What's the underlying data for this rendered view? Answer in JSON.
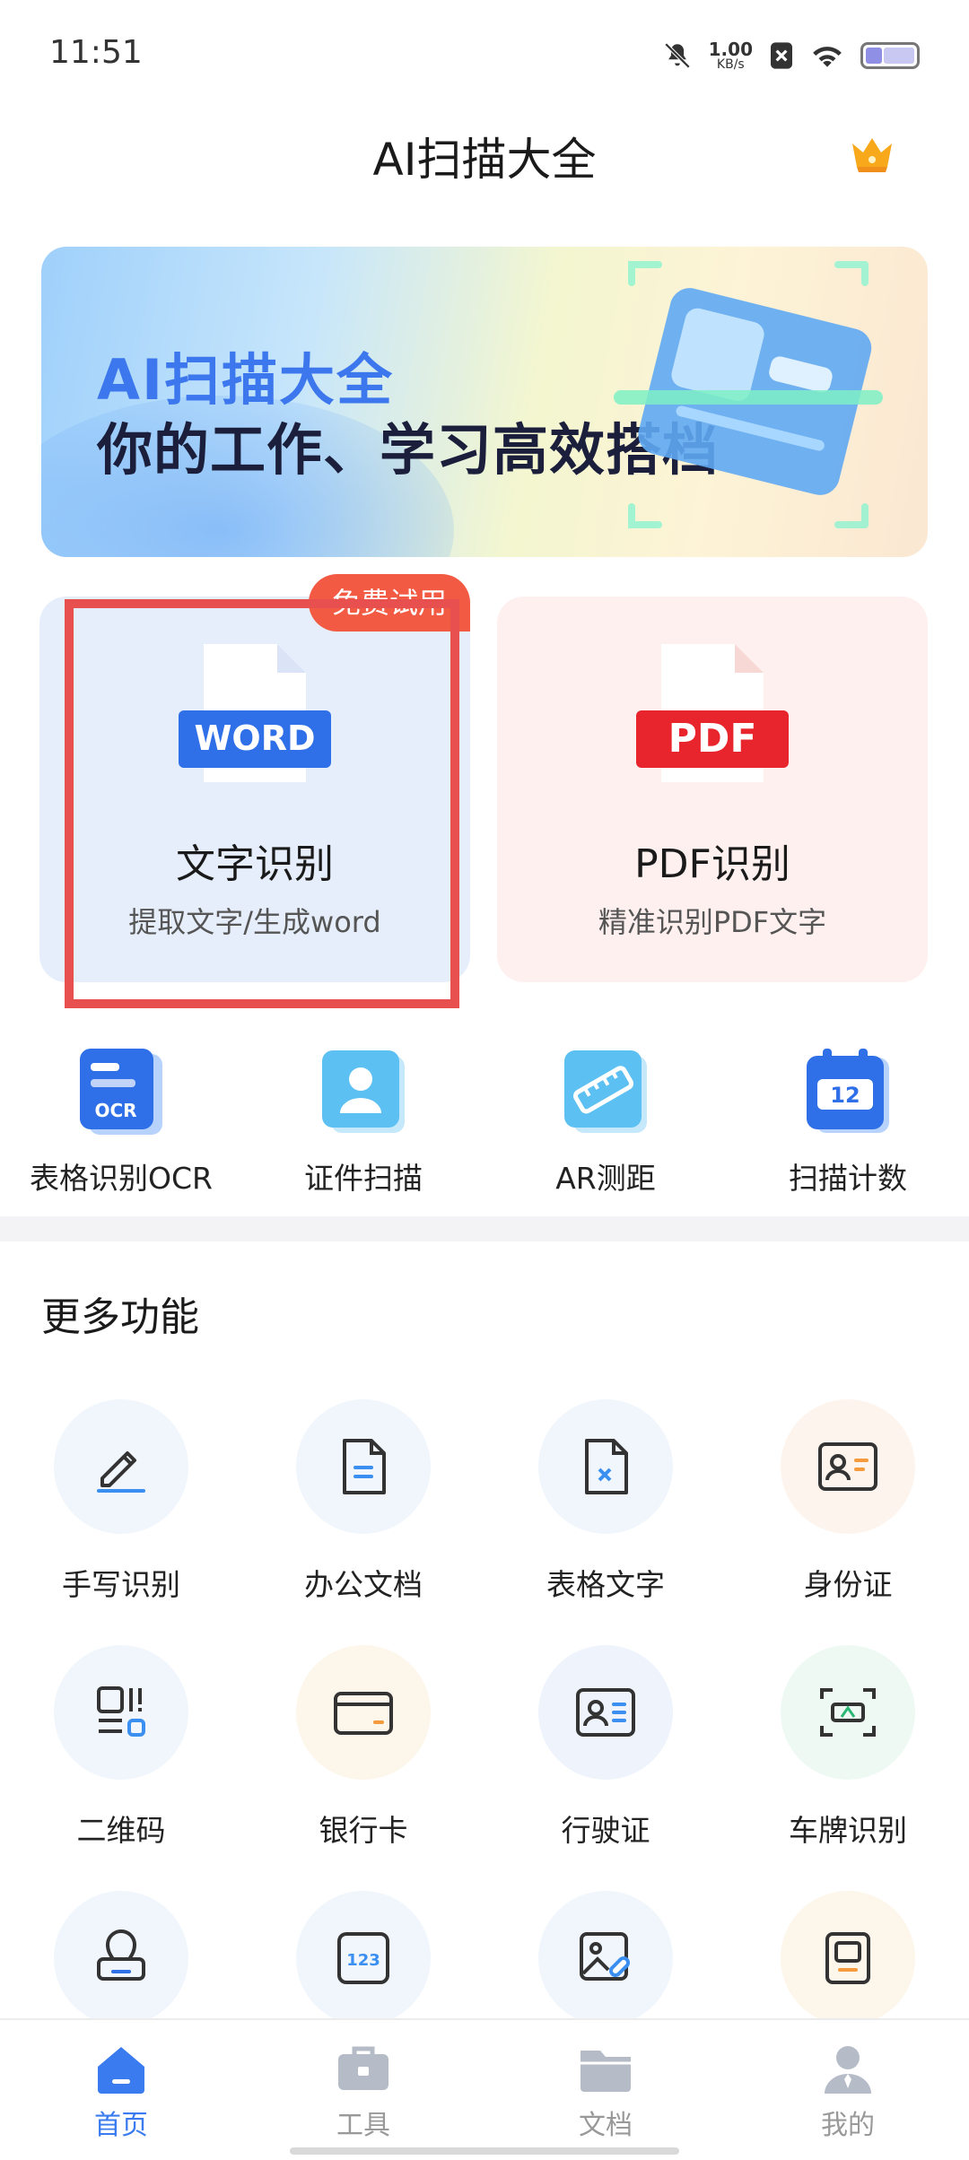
{
  "status_bar": {
    "time": "11:51",
    "net_speed_value": "1.00",
    "net_speed_unit": "KB/s",
    "icons": [
      "mute-bell-icon",
      "sim-blocked-icon",
      "wifi-icon",
      "battery-icon"
    ]
  },
  "header": {
    "title": "AI扫描大全",
    "vip_icon": "crown-icon"
  },
  "banner": {
    "line1": "AI扫描大全",
    "line2": "你的工作、学习高效搭档"
  },
  "cards": {
    "word": {
      "icon_text": "WORD",
      "title": "文字识别",
      "subtitle": "提取文字/生成word",
      "badge": "免费试用"
    },
    "pdf": {
      "icon_text": "PDF",
      "title": "PDF识别",
      "subtitle": "精准识别PDF文字"
    }
  },
  "quick_tools": [
    {
      "label": "表格识别OCR",
      "icon": "ocr-table-icon",
      "icon_text": "OCR"
    },
    {
      "label": "证件扫描",
      "icon": "id-scan-icon"
    },
    {
      "label": "AR测距",
      "icon": "ruler-icon"
    },
    {
      "label": "扫描计数",
      "icon": "count-icon",
      "icon_text": "12"
    }
  ],
  "more": {
    "title": "更多功能",
    "items": [
      {
        "label": "手写识别",
        "icon": "pen-icon"
      },
      {
        "label": "办公文档",
        "icon": "document-icon"
      },
      {
        "label": "表格文字",
        "icon": "excel-file-icon"
      },
      {
        "label": "身份证",
        "icon": "id-card-icon"
      },
      {
        "label": "二维码",
        "icon": "qr-code-icon"
      },
      {
        "label": "银行卡",
        "icon": "bank-card-icon"
      },
      {
        "label": "行驶证",
        "icon": "driving-license-icon"
      },
      {
        "label": "车牌识别",
        "icon": "license-plate-icon"
      },
      {
        "label": "",
        "icon": "stamp-icon"
      },
      {
        "label": "",
        "icon": "number-icon",
        "icon_text": "123"
      },
      {
        "label": "",
        "icon": "image-link-icon"
      },
      {
        "label": "",
        "icon": "certificate-icon"
      }
    ]
  },
  "nav": {
    "items": [
      {
        "label": "首页",
        "icon": "home-icon",
        "active": true
      },
      {
        "label": "工具",
        "icon": "toolbox-icon",
        "active": false
      },
      {
        "label": "文档",
        "icon": "folder-icon",
        "active": false
      },
      {
        "label": "我的",
        "icon": "profile-icon",
        "active": false
      }
    ]
  },
  "colors": {
    "accent": "#3a7bf0",
    "highlight_border": "#e85050",
    "badge": "#f25a43"
  }
}
